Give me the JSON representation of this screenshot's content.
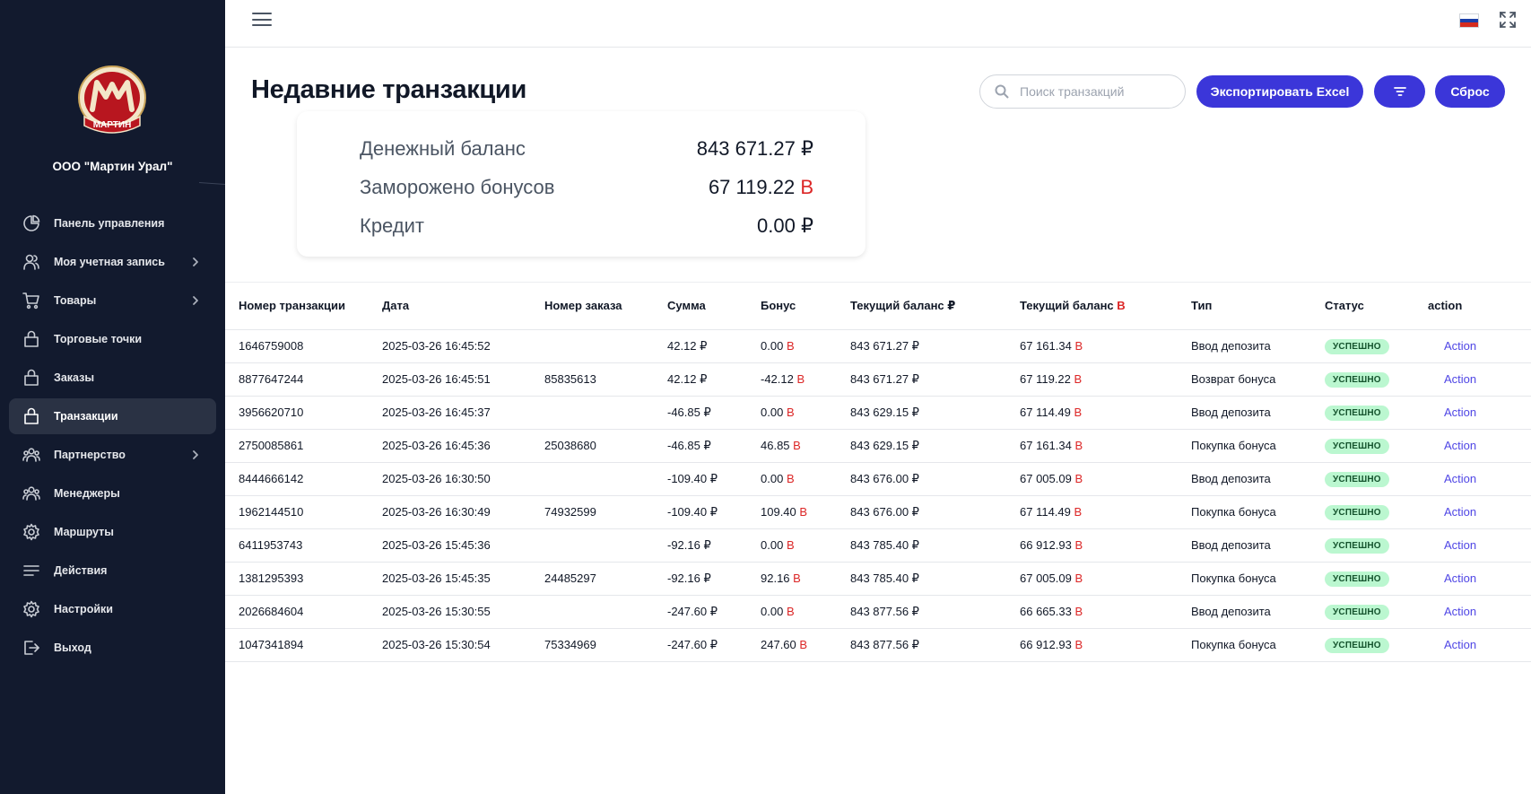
{
  "sidebar": {
    "logo_text": "МАРТИН",
    "company": "ООО \"Мартин Урал\"",
    "items": [
      {
        "label": "Панель управления",
        "icon": "pie-chart-icon",
        "chevron": false,
        "active": false
      },
      {
        "label": "Моя учетная запись",
        "icon": "users-icon",
        "chevron": true,
        "active": false
      },
      {
        "label": "Товары",
        "icon": "cart-icon",
        "chevron": true,
        "active": false
      },
      {
        "label": "Торговые точки",
        "icon": "bag-icon",
        "chevron": false,
        "active": false
      },
      {
        "label": "Заказы",
        "icon": "bag-icon",
        "chevron": false,
        "active": false
      },
      {
        "label": "Транзакции",
        "icon": "bag-icon",
        "chevron": false,
        "active": true
      },
      {
        "label": "Партнерство",
        "icon": "group-icon",
        "chevron": true,
        "active": false
      },
      {
        "label": "Менеджеры",
        "icon": "group-icon",
        "chevron": false,
        "active": false
      },
      {
        "label": "Маршруты",
        "icon": "gear-icon",
        "chevron": false,
        "active": false
      },
      {
        "label": "Действия",
        "icon": "list-icon",
        "chevron": false,
        "active": false
      },
      {
        "label": "Настройки",
        "icon": "gear-icon",
        "chevron": false,
        "active": false
      },
      {
        "label": "Выход",
        "icon": "logout-icon",
        "chevron": false,
        "active": false
      }
    ]
  },
  "header": {
    "title": "Недавние транзакции",
    "search_placeholder": "Поиск транзакций",
    "export_label": "Экспортировать Excel",
    "reset_label": "Сброс"
  },
  "balance": {
    "rows": [
      {
        "label": "Денежный баланс",
        "amount": "843 671.27",
        "unit": "₽",
        "unit_red": false
      },
      {
        "label": "Заморожено бонусов",
        "amount": "67 119.22",
        "unit": "B",
        "unit_red": true
      },
      {
        "label": "Кредит",
        "amount": "0.00",
        "unit": "₽",
        "unit_red": false
      }
    ]
  },
  "table": {
    "columns": [
      "Номер транзакции",
      "Дата",
      "Номер заказа",
      "Сумма",
      "Бонус",
      "Текущий баланс ₽",
      "Текущий баланс",
      "Тип",
      "Статус",
      "action"
    ],
    "bonus_unit": "B",
    "rub_unit": "₽",
    "rows": [
      {
        "id": "1646759008",
        "date": "2025-03-26 16:45:52",
        "order": "",
        "sum": "42.12 ₽",
        "bonus": "0.00",
        "bal_rub": "843 671.27 ₽",
        "bal_b": "67 161.34",
        "type": "Ввод депозита",
        "status": "УСПЕШНО",
        "action": "Action"
      },
      {
        "id": "8877647244",
        "date": "2025-03-26 16:45:51",
        "order": "85835613",
        "sum": "42.12 ₽",
        "bonus": "-42.12",
        "bal_rub": "843 671.27 ₽",
        "bal_b": "67 119.22",
        "type": "Возврат бонуса",
        "status": "УСПЕШНО",
        "action": "Action"
      },
      {
        "id": "3956620710",
        "date": "2025-03-26 16:45:37",
        "order": "",
        "sum": "-46.85 ₽",
        "bonus": "0.00",
        "bal_rub": "843 629.15 ₽",
        "bal_b": "67 114.49",
        "type": "Ввод депозита",
        "status": "УСПЕШНО",
        "action": "Action"
      },
      {
        "id": "2750085861",
        "date": "2025-03-26 16:45:36",
        "order": "25038680",
        "sum": "-46.85 ₽",
        "bonus": "46.85",
        "bal_rub": "843 629.15 ₽",
        "bal_b": "67 161.34",
        "type": "Покупка бонуса",
        "status": "УСПЕШНО",
        "action": "Action"
      },
      {
        "id": "8444666142",
        "date": "2025-03-26 16:30:50",
        "order": "",
        "sum": "-109.40 ₽",
        "bonus": "0.00",
        "bal_rub": "843 676.00 ₽",
        "bal_b": "67 005.09",
        "type": "Ввод депозита",
        "status": "УСПЕШНО",
        "action": "Action"
      },
      {
        "id": "1962144510",
        "date": "2025-03-26 16:30:49",
        "order": "74932599",
        "sum": "-109.40 ₽",
        "bonus": "109.40",
        "bal_rub": "843 676.00 ₽",
        "bal_b": "67 114.49",
        "type": "Покупка бонуса",
        "status": "УСПЕШНО",
        "action": "Action"
      },
      {
        "id": "6411953743",
        "date": "2025-03-26 15:45:36",
        "order": "",
        "sum": "-92.16 ₽",
        "bonus": "0.00",
        "bal_rub": "843 785.40 ₽",
        "bal_b": "66 912.93",
        "type": "Ввод депозита",
        "status": "УСПЕШНО",
        "action": "Action"
      },
      {
        "id": "1381295393",
        "date": "2025-03-26 15:45:35",
        "order": "24485297",
        "sum": "-92.16 ₽",
        "bonus": "92.16",
        "bal_rub": "843 785.40 ₽",
        "bal_b": "67 005.09",
        "type": "Покупка бонуса",
        "status": "УСПЕШНО",
        "action": "Action"
      },
      {
        "id": "2026684604",
        "date": "2025-03-26 15:30:55",
        "order": "",
        "sum": "-247.60 ₽",
        "bonus": "0.00",
        "bal_rub": "843 877.56 ₽",
        "bal_b": "66 665.33",
        "type": "Ввод депозита",
        "status": "УСПЕШНО",
        "action": "Action"
      },
      {
        "id": "1047341894",
        "date": "2025-03-26 15:30:54",
        "order": "75334969",
        "sum": "-247.60 ₽",
        "bonus": "247.60",
        "bal_rub": "843 877.56 ₽",
        "bal_b": "66 912.93",
        "type": "Покупка бонуса",
        "status": "УСПЕШНО",
        "action": "Action"
      }
    ]
  },
  "colors": {
    "sidebar_bg": "#121a2e",
    "accent": "#3b36d9",
    "bonus_red": "#dc2626",
    "badge_green": "#bbf7d0",
    "link": "#4f46e5"
  }
}
